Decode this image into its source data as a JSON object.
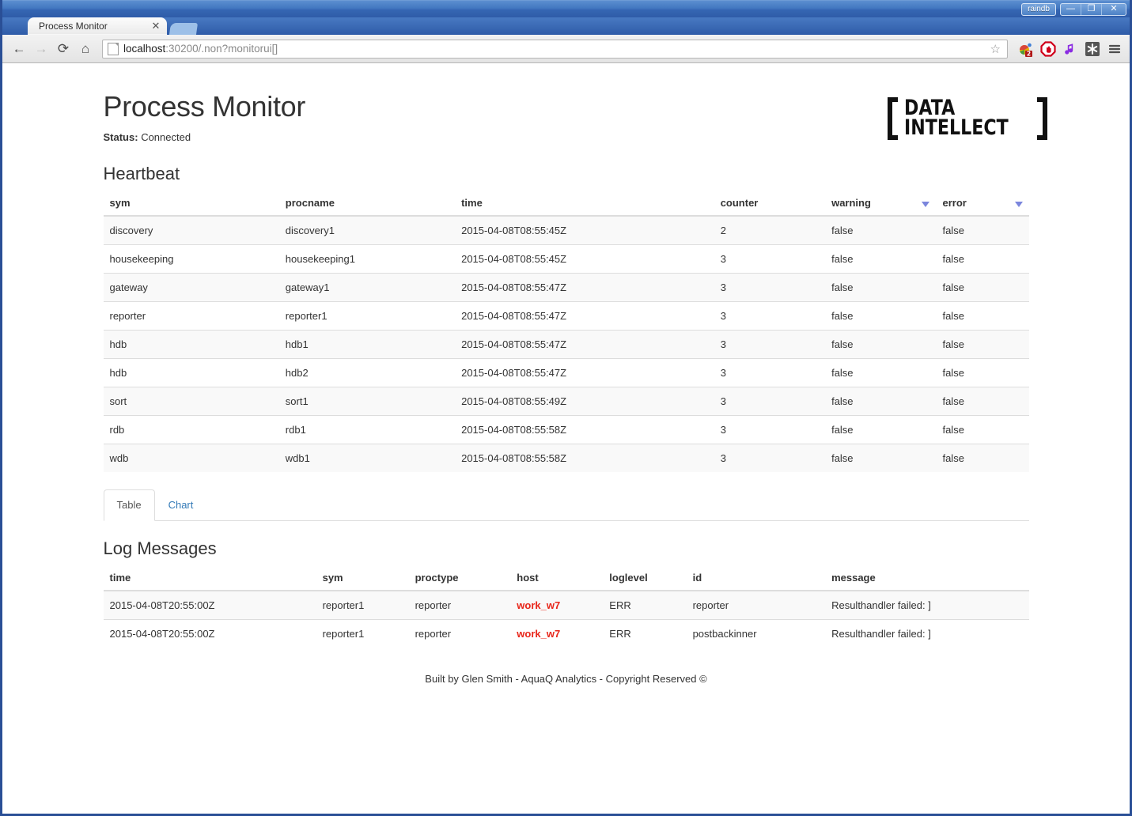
{
  "window": {
    "app_label": "raindb",
    "minimize": "—",
    "maximize": "❐",
    "close": "✕"
  },
  "browser": {
    "tab_title": "Process Monitor",
    "tab_close": "✕",
    "back_icon": "←",
    "forward_icon": "→",
    "reload_icon": "⟳",
    "home_icon": "⌂",
    "url_host": "localhost",
    "url_rest": ":30200/.non?monitorui[]",
    "bookmark_icon": "☆",
    "extensions": [
      {
        "name": "google-drive-extension-icon",
        "badge": "2"
      },
      {
        "name": "adblock-icon",
        "badge": ""
      },
      {
        "name": "music-note-icon",
        "badge": ""
      },
      {
        "name": "asterisk-extension-icon",
        "badge": ""
      },
      {
        "name": "chrome-menu-icon",
        "badge": ""
      }
    ]
  },
  "page": {
    "title": "Process Monitor",
    "status_label": "Status:",
    "status_value": "Connected",
    "logo_line1": "DATA",
    "logo_line2": "INTELLECT",
    "footer": "Built by Glen Smith - AquaQ Analytics - Copyright Reserved ©"
  },
  "heartbeat": {
    "heading": "Heartbeat",
    "columns": [
      "sym",
      "procname",
      "time",
      "counter",
      "warning",
      "error"
    ],
    "sortable_columns": [
      "warning",
      "error"
    ],
    "rows": [
      [
        "discovery",
        "discovery1",
        "2015-04-08T08:55:45Z",
        "2",
        "false",
        "false"
      ],
      [
        "housekeeping",
        "housekeeping1",
        "2015-04-08T08:55:45Z",
        "3",
        "false",
        "false"
      ],
      [
        "gateway",
        "gateway1",
        "2015-04-08T08:55:47Z",
        "3",
        "false",
        "false"
      ],
      [
        "reporter",
        "reporter1",
        "2015-04-08T08:55:47Z",
        "3",
        "false",
        "false"
      ],
      [
        "hdb",
        "hdb1",
        "2015-04-08T08:55:47Z",
        "3",
        "false",
        "false"
      ],
      [
        "hdb",
        "hdb2",
        "2015-04-08T08:55:47Z",
        "3",
        "false",
        "false"
      ],
      [
        "sort",
        "sort1",
        "2015-04-08T08:55:49Z",
        "3",
        "false",
        "false"
      ],
      [
        "rdb",
        "rdb1",
        "2015-04-08T08:55:58Z",
        "3",
        "false",
        "false"
      ],
      [
        "wdb",
        "wdb1",
        "2015-04-08T08:55:58Z",
        "3",
        "false",
        "false"
      ]
    ]
  },
  "view_tabs": {
    "items": [
      {
        "label": "Table",
        "active": true
      },
      {
        "label": "Chart",
        "active": false
      }
    ]
  },
  "log_messages": {
    "heading": "Log Messages",
    "columns": [
      "time",
      "sym",
      "proctype",
      "host",
      "loglevel",
      "id",
      "message"
    ],
    "rows": [
      [
        "2015-04-08T20:55:00Z",
        "reporter1",
        "reporter",
        "work_w7",
        "ERR",
        "reporter",
        "Resulthandler failed: ]"
      ],
      [
        "2015-04-08T20:55:00Z",
        "reporter1",
        "reporter",
        "work_w7",
        "ERR",
        "postbackinner",
        "Resulthandler failed: ]"
      ]
    ],
    "host_color": "#e8261a"
  },
  "colors": {
    "link": "#337ab7",
    "sort_arrow": "#7b86dd",
    "row_stripe": "#f9f9f9",
    "border": "#dddddd",
    "chrome_blue": "#2f5ca8"
  }
}
